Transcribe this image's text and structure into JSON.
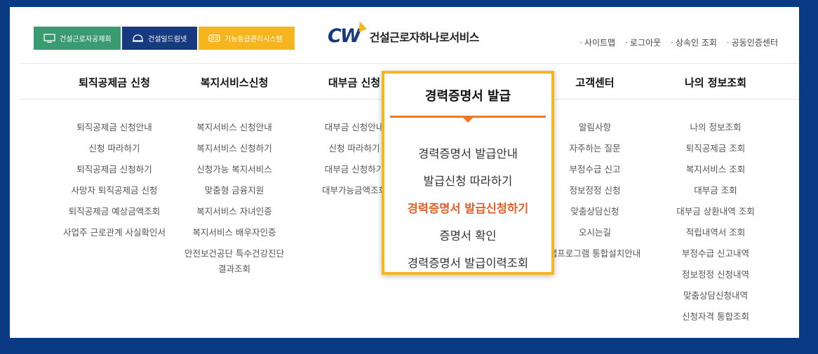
{
  "family_sites": [
    {
      "label": "건설근로자공제회",
      "icon": "monitor-icon",
      "color": "#3a9a72"
    },
    {
      "label": "건설일드림넷",
      "icon": "helmet-icon",
      "color": "#163a7f"
    },
    {
      "label": "기능등급관리시스템",
      "icon": "badge-icon",
      "color": "#f6b51f"
    }
  ],
  "logo": {
    "mark": "CW",
    "text": "건설근로자하나로서비스"
  },
  "utility_links": [
    "사이트맵",
    "로그아웃",
    "상속인 조회",
    "공동인증센터"
  ],
  "menus": [
    {
      "title": "퇴직공제금 신청",
      "items": [
        "퇴직공제금 신청안내",
        "신청 따라하기",
        "퇴직공제금 신청하기",
        "사망자 퇴직공제금 신청",
        "퇴직공제금 예상금액조회",
        "사업주 근로관계 사실확인서"
      ]
    },
    {
      "title": "복지서비스신청",
      "items": [
        "복지서비스 신청안내",
        "복지서비스 신청하기",
        "신청가능 복지서비스",
        "맞춤형 금융지원",
        "복지서비스 자녀인증",
        "복지서비스 배우자인증"
      ],
      "extra_item": [
        "안전보건공단 특수건강진단",
        "결과조회"
      ]
    },
    {
      "title": "대부금 신청",
      "items": [
        "대부금 신청안내",
        "신청 따라하기",
        "대부금 신청하기",
        "대부가능금액조회"
      ]
    },
    {
      "title": "고객센터",
      "items": [
        "알림사항",
        "자주하는 질문",
        "부정수급 신고",
        "정보정정 신청",
        "맞춤상담신청",
        "오시는길",
        "앱프로그램 통합설치안내"
      ]
    },
    {
      "title": "나의 정보조회",
      "items": [
        "나의 정보조회",
        "퇴직공제금 조회",
        "복지서비스 조회",
        "대부금 조회",
        "대부금 상환내역 조회",
        "적립내역서 조회",
        "부정수급 신고내역",
        "정보정정 신청내역",
        "맞춤상담신청내역",
        "신청자격 통합조회"
      ]
    }
  ],
  "popup": {
    "title": "경력증명서 발급",
    "items": [
      "경력증명서 발급안내",
      "발급신청 따라하기",
      "경력증명서 발급신청하기",
      "증명서 확인",
      "경력증명서 발급이력조회"
    ],
    "active_index": 2,
    "accent_color": "#ee7a25",
    "border_color": "#f4b621"
  }
}
